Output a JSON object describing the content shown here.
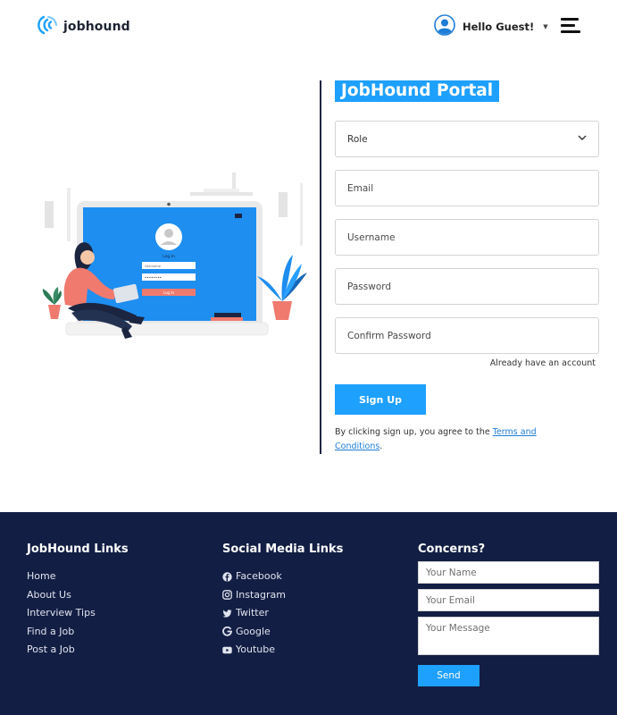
{
  "header": {
    "logo_text": "jobhound",
    "greeting": "Hello Guest!",
    "brand_color": "#1ea0ff"
  },
  "main": {
    "portal_title": "JobHound Portal",
    "role_select": {
      "value": "Role"
    },
    "email_placeholder": "Email",
    "username_placeholder": "Username",
    "password_placeholder": "Password",
    "confirm_password_placeholder": "Confirm Password",
    "already_account_label": "Already have an account",
    "signup_label": "Sign Up",
    "terms_prefix": "By clicking sign up, you agree to the ",
    "terms_link": "Terms and Conditions",
    "terms_suffix": ".",
    "illustration": {
      "login_heading": "Log In",
      "username_field": "Username",
      "password_field": "••••••••",
      "login_button": "Log In"
    }
  },
  "footer": {
    "background_color": "#131e44",
    "links_title": "JobHound Links",
    "links": [
      "Home",
      "About Us",
      "Interview Tips",
      "Find a Job",
      "Post a Job"
    ],
    "social_title": "Social Media Links",
    "social": [
      {
        "icon": "facebook-icon",
        "label": "Facebook"
      },
      {
        "icon": "instagram-icon",
        "label": "Instagram"
      },
      {
        "icon": "twitter-icon",
        "label": "Twitter"
      },
      {
        "icon": "google-icon",
        "label": "Google"
      },
      {
        "icon": "youtube-icon",
        "label": "Youtube"
      }
    ],
    "concerns_title": "Concerns?",
    "name_placeholder": "Your Name",
    "email_placeholder": "Your Email",
    "message_placeholder": "Your Message",
    "send_label": "Send"
  }
}
